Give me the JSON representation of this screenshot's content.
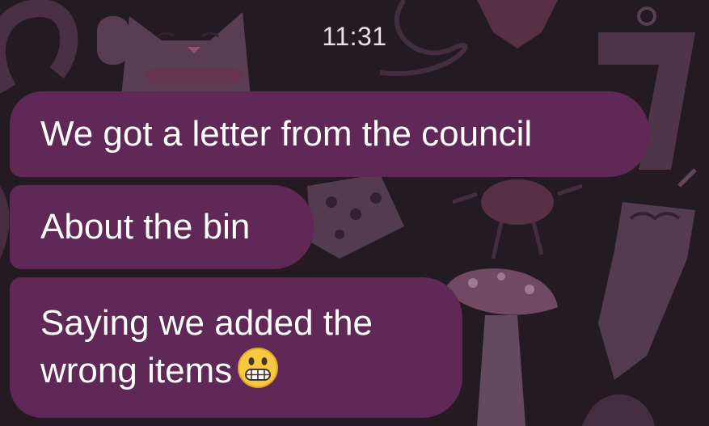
{
  "status": {
    "time": "11:31"
  },
  "messages": [
    {
      "text": "We got a letter from the council"
    },
    {
      "text": "About the bin"
    },
    {
      "line1": "Saying we added the",
      "line2": "wrong items",
      "emoji": "grimacing-face-emoji"
    }
  ],
  "theme": {
    "bubble_color": "#5f2857",
    "background_color": "#241a22",
    "text_color": "#ffffff"
  }
}
